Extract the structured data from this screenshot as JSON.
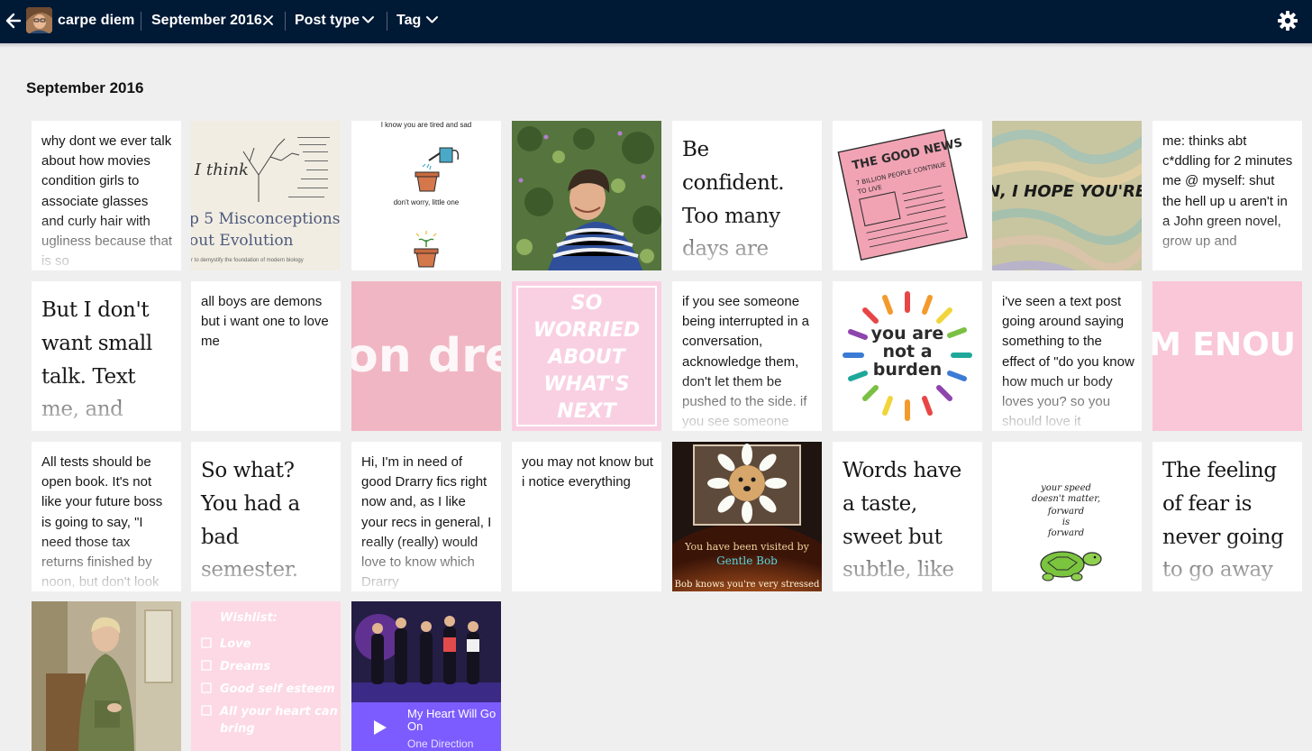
{
  "header": {
    "blog_name": "carpe diem",
    "date_filter": "September 2016",
    "post_type_label": "Post type",
    "tag_label": "Tag"
  },
  "page": {
    "title": "September 2016"
  },
  "tiles": {
    "t1": "why dont we ever talk about how movies condition girls to associate glasses and curly hair with ugliness because that is so",
    "t2": {
      "cursive": "I think",
      "title_line1": "p 5 Misconceptions",
      "title_line2": "out Evolution",
      "caption": "r to demystify the foundation of modern biology"
    },
    "t3": {
      "top": "I know you are tired and sad",
      "bottom": "don't worry, little one"
    },
    "t5": "Be confident. Too many days are wasted",
    "t6": {
      "headline": "THE GOOD NEWS",
      "line1": "7 BILLION PEOPLE CONTINUE",
      "line2": "TO LIVE"
    },
    "t7": "N, I HOPE YOU'RE H",
    "t8": "me: thinks abt c*ddling for 2 minutes\nme @ myself: shut the hell up u aren't in a John green novel, grow up and",
    "t9": "But I don't want small talk. Text me, and",
    "t10": "all boys are demons but i want one to love me",
    "t11": "on dre",
    "t12": [
      "SO",
      "WORRIED",
      "ABOUT",
      "WHAT'S",
      "NEXT"
    ],
    "t13": "if you see someone being interrupted in a conversation, acknowledge them, don't let them be pushed to the side. if you see someone",
    "t14": [
      "you are",
      "not a",
      "burden"
    ],
    "t15": "i've seen a text post going around saying something to the effect of \"do you know how much ur body loves you? so you should love it",
    "t16": "M ENOU",
    "t17": "All tests should be open book. It's not like your future boss is going to say, \"I need those tax returns finished by noon, but don't look",
    "t18": "So what? You had a bad semester.",
    "t19": "Hi, I'm in need of good Drarry fics right now and, as I like your recs in general, I really (really) would love to know which Drarry",
    "t20": "you may not know but i notice everything",
    "t21": {
      "line1": "You have been visited by",
      "line2": "Gentle Bob",
      "line3": "Bob knows you're very stressed"
    },
    "t22": "Words have a taste, sweet but subtle, like dark",
    "t23": [
      "your speed",
      "doesn't matter,",
      "forward",
      "is",
      "forward"
    ],
    "t24": "The feeling of fear is never going to go away",
    "t26": {
      "title": "Wishlist:",
      "items": [
        "Love",
        "Dreams",
        "Good self esteem",
        "All your heart can",
        "bring"
      ]
    },
    "t27": {
      "song": "My Heart Will Go On",
      "artist": "One Direction"
    }
  }
}
